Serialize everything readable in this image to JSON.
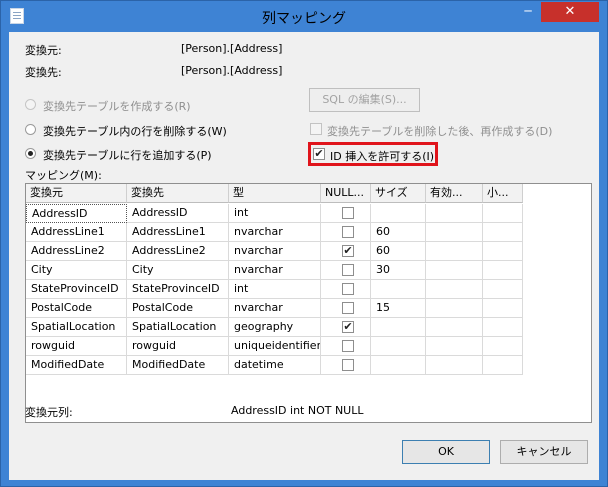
{
  "window": {
    "title": "列マッピング",
    "minimize_label": "─",
    "close_label": "✕"
  },
  "source": {
    "label": "変換元:",
    "value": "[Person].[Address]"
  },
  "destination": {
    "label": "変換先:",
    "value": "[Person].[Address]"
  },
  "options": {
    "create_table": "変換先テーブルを作成する(R)",
    "delete_rows": "変換先テーブル内の行を削除する(W)",
    "append_rows": "変換先テーブルに行を追加する(P)",
    "sql_edit": "SQL の編集(S)...",
    "drop_recreate": "変換先テーブルを削除した後、再作成する(D)",
    "identity_insert": "ID 挿入を許可する(I)",
    "selected_option": "append_rows",
    "identity_insert_checked": true
  },
  "mappings": {
    "label": "マッピング(M):",
    "headers": [
      "変換元",
      "変換先",
      "型",
      "NULL...",
      "サイズ",
      "有効...",
      "小..."
    ],
    "rows": [
      {
        "source": "AddressID",
        "destination": "AddressID",
        "type": "int",
        "nullable": false,
        "size": ""
      },
      {
        "source": "AddressLine1",
        "destination": "AddressLine1",
        "type": "nvarchar",
        "nullable": false,
        "size": "60"
      },
      {
        "source": "AddressLine2",
        "destination": "AddressLine2",
        "type": "nvarchar",
        "nullable": true,
        "size": "60"
      },
      {
        "source": "City",
        "destination": "City",
        "type": "nvarchar",
        "nullable": false,
        "size": "30"
      },
      {
        "source": "StateProvinceID",
        "destination": "StateProvinceID",
        "type": "int",
        "nullable": false,
        "size": ""
      },
      {
        "source": "PostalCode",
        "destination": "PostalCode",
        "type": "nvarchar",
        "nullable": false,
        "size": "15"
      },
      {
        "source": "SpatialLocation",
        "destination": "SpatialLocation",
        "type": "geography",
        "nullable": true,
        "size": ""
      },
      {
        "source": "rowguid",
        "destination": "rowguid",
        "type": "uniqueidentifier",
        "nullable": false,
        "size": ""
      },
      {
        "source": "ModifiedDate",
        "destination": "ModifiedDate",
        "type": "datetime",
        "nullable": false,
        "size": ""
      }
    ]
  },
  "source_column": {
    "label": "変換元列:",
    "value": "AddressID int NOT NULL"
  },
  "buttons": {
    "ok": "OK",
    "cancel": "キャンセル"
  },
  "check_mark": "✔"
}
